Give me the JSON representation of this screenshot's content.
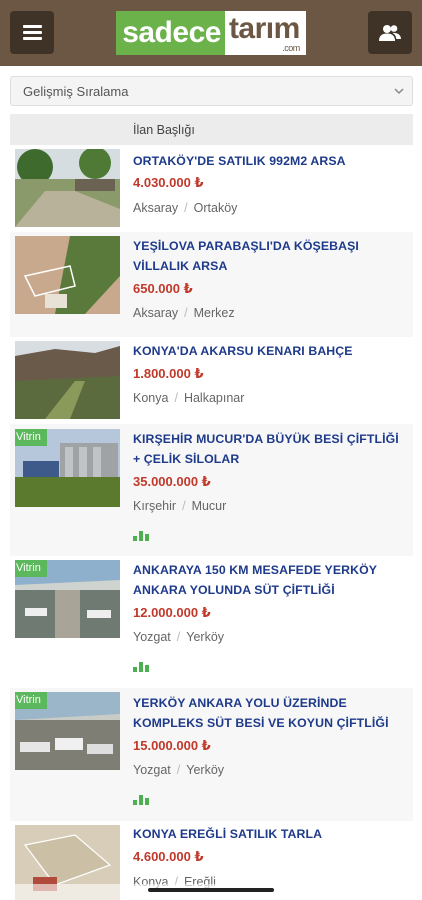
{
  "header": {
    "logo_part1": "sadece",
    "logo_part2": "tarım",
    "logo_suffix": ".com",
    "menu_icon": "menu-icon",
    "user_icon": "users-icon"
  },
  "sort": {
    "label": "Gelişmiş Sıralama"
  },
  "table": {
    "column_header": "İlan Başlığı"
  },
  "listings": [
    {
      "title": "ORTAKÖY'DE SATILIK 992M2 ARSA",
      "price": "4.030.000 ₺",
      "city": "Aksaray",
      "district": "Ortaköy",
      "badge": "",
      "stats": false
    },
    {
      "title": "YEŞİLOVA PARABAŞLI'DA KÖŞEBAŞI VİLLALIK ARSA",
      "price": "650.000 ₺",
      "city": "Aksaray",
      "district": "Merkez",
      "badge": "",
      "stats": false
    },
    {
      "title": "KONYA'DA AKARSU KENARI BAHÇE",
      "price": "1.800.000 ₺",
      "city": "Konya",
      "district": "Halkapınar",
      "badge": "",
      "stats": false
    },
    {
      "title": "KIRŞEHİR MUCUR'DA BÜYÜK BESİ ÇİFTLİĞİ + ÇELİK SİLOLAR",
      "price": "35.000.000 ₺",
      "city": "Kırşehir",
      "district": "Mucur",
      "badge": "Vitrin",
      "stats": true
    },
    {
      "title": "ANKARAYA 150 KM MESAFEDE YERKÖY ANKARA YOLUNDA SÜT ÇİFTLİĞİ",
      "price": "12.000.000 ₺",
      "city": "Yozgat",
      "district": "Yerköy",
      "badge": "Vitrin",
      "stats": true
    },
    {
      "title": "YERKÖY ANKARA YOLU ÜZERİNDE KOMPLEKS SÜT BESİ VE KOYUN ÇİFTLİĞİ",
      "price": "15.000.000 ₺",
      "city": "Yozgat",
      "district": "Yerköy",
      "badge": "Vitrin",
      "stats": true
    },
    {
      "title": "KONYA EREĞLİ SATILIK TARLA",
      "price": "4.600.000 ₺",
      "city": "Konya",
      "district": "Ereğli",
      "badge": "",
      "stats": false
    }
  ]
}
